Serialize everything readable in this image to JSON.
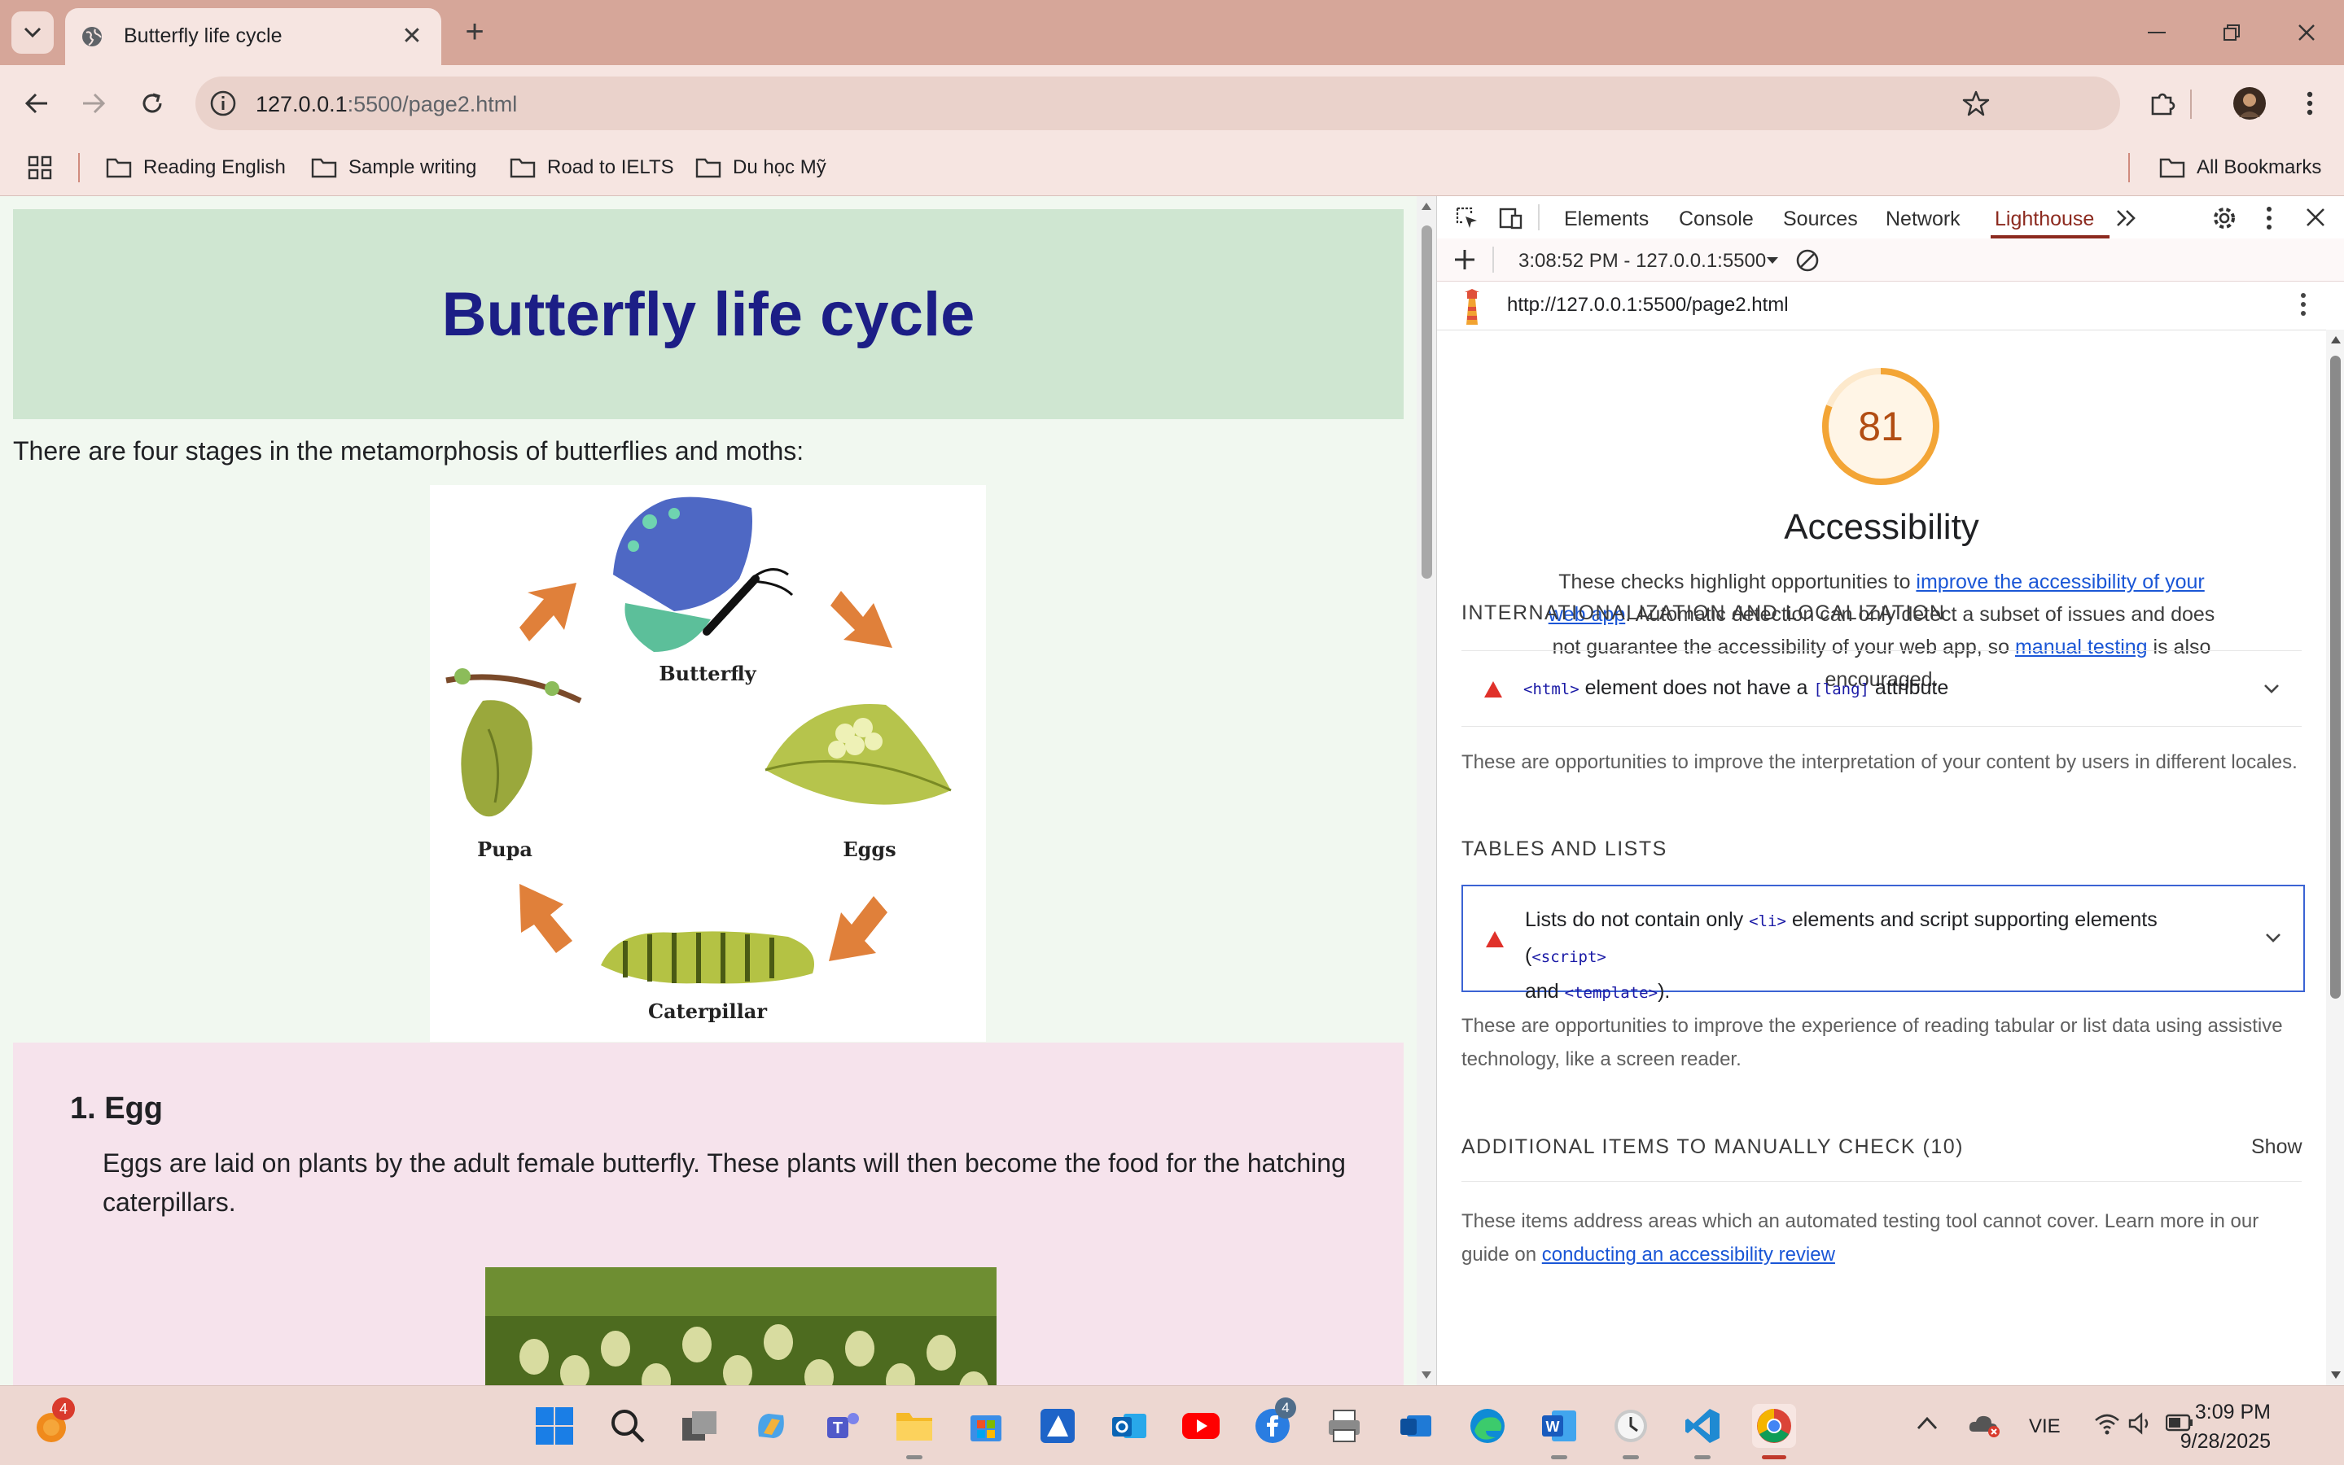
{
  "browser": {
    "tab_title": "Butterfly life cycle",
    "url_host": "127.0.0.1",
    "url_path": ":5500/page2.html",
    "bookmarks": [
      "Reading English",
      "Sample writing",
      "Road to IELTS",
      "Du học Mỹ"
    ],
    "all_bookmarks": "All Bookmarks"
  },
  "page": {
    "title": "Butterfly life cycle",
    "intro": "There are four stages in the metamorphosis of butterflies and moths:",
    "diagram_labels": {
      "butterfly": "Butterfly",
      "eggs": "Eggs",
      "caterpillar": "Caterpillar",
      "pupa": "Pupa"
    },
    "egg_section": {
      "heading": "1. Egg",
      "text": "Eggs are laid on plants by the adult female butterfly. These plants will then become the food for the hatching caterpillars."
    }
  },
  "devtools": {
    "tabs": [
      "Elements",
      "Console",
      "Sources",
      "Network",
      "Lighthouse"
    ],
    "active_tab": "Lighthouse",
    "report_time": "3:08:52 PM - 127.0.0.1:5500",
    "report_url": "http://127.0.0.1:5500/page2.html",
    "score": "81",
    "score_fraction": 0.81,
    "category_title": "Accessibility",
    "category_desc_1": "These checks highlight opportunities to ",
    "category_desc_link1": "improve the accessibility of your web app",
    "category_desc_2": ". Automatic detection can only detect a subset of issues and does not guarantee the accessibility of your web app, so ",
    "category_desc_link2": "manual testing",
    "category_desc_3": " is also encouraged.",
    "groups": {
      "i18n": {
        "title": "INTERNATIONALIZATION AND LOCALIZATION",
        "audit_code1": "<html>",
        "audit_text1": " element does not have a ",
        "audit_code2": "[lang]",
        "audit_text2": " attribute",
        "desc": "These are opportunities to improve the interpretation of your content by users in different locales."
      },
      "tables": {
        "title": "TABLES AND LISTS",
        "audit_text1": "Lists do not contain only ",
        "audit_code1": "<li>",
        "audit_text2": " elements and script supporting elements (",
        "audit_code2": "<script>",
        "audit_text3": "and ",
        "audit_code3": "<template>",
        "audit_text4": ").",
        "desc": "These are opportunities to improve the experience of reading tabular or list data using assistive technology, like a screen reader."
      },
      "manual": {
        "title": "ADDITIONAL ITEMS TO MANUALLY CHECK (10)",
        "show": "Show",
        "desc_1": "These items address areas which an automated testing tool cannot cover. Learn more in our guide on ",
        "desc_link": "conducting an accessibility review"
      }
    }
  },
  "taskbar": {
    "badge_count": "4",
    "messenger_badge": "4",
    "language": "VIE",
    "time": "3:09 PM",
    "date": "9/28/2025"
  },
  "colors": {
    "titlebar": "#d6a699",
    "lighthouse_accent": "#8c2a1f",
    "score_orange": "#f3a536",
    "fail_red": "#e0312a",
    "header_title": "#1c1e86"
  }
}
